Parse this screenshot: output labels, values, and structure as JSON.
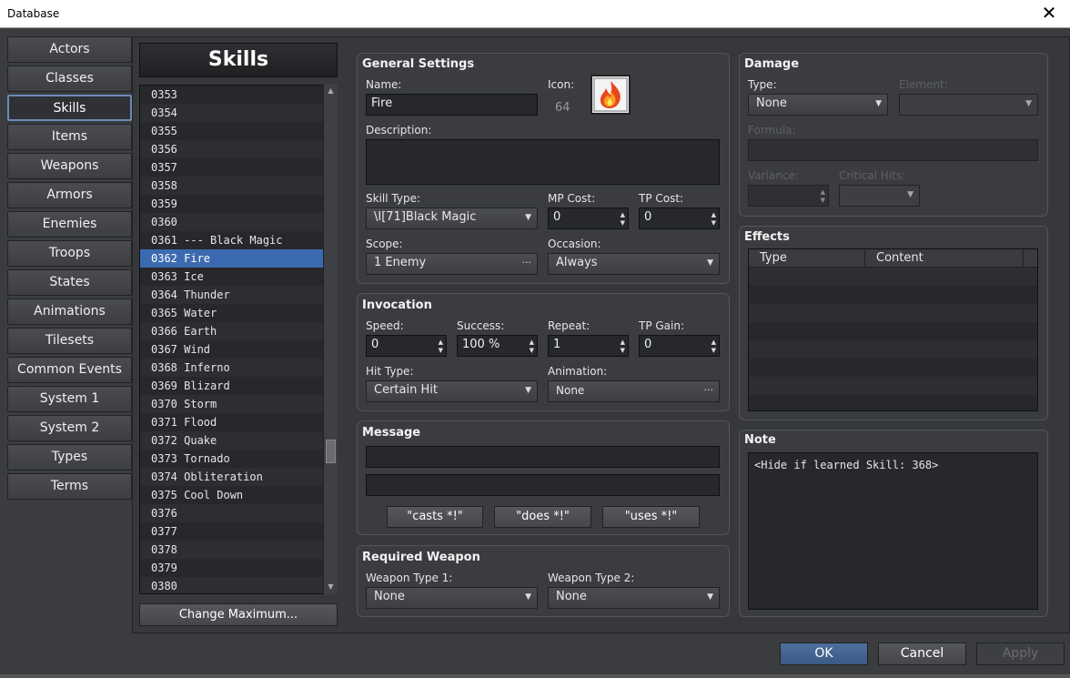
{
  "window": {
    "title": "Database",
    "close_glyph": "✕"
  },
  "nav": [
    "Actors",
    "Classes",
    "Skills",
    "Items",
    "Weapons",
    "Armors",
    "Enemies",
    "Troops",
    "States",
    "Animations",
    "Tilesets",
    "Common Events",
    "System 1",
    "System 2",
    "Types",
    "Terms"
  ],
  "nav_active_index": 2,
  "list": {
    "title": "Skills",
    "rows": [
      "0353",
      "0354",
      "0355",
      "0356",
      "0357",
      "0358",
      "0359",
      "0360",
      "0361 --- Black Magic",
      "0362 Fire",
      "0363 Ice",
      "0364 Thunder",
      "0365 Water",
      "0366 Earth",
      "0367 Wind",
      "0368 Inferno",
      "0369 Blizard",
      "0370 Storm",
      "0371 Flood",
      "0372 Quake",
      "0373 Tornado",
      "0374 Obliteration",
      "0375 Cool Down",
      "0376",
      "0377",
      "0378",
      "0379",
      "0380"
    ],
    "selected_index": 9,
    "change_max": "Change Maximum..."
  },
  "general": {
    "title": "General Settings",
    "name_label": "Name:",
    "name": "Fire",
    "icon_label": "Icon:",
    "icon_index": "64",
    "icon_name": "fire-skill-icon",
    "description_label": "Description:",
    "description": "",
    "skill_type_label": "Skill Type:",
    "skill_type": "\\I[71]Black Magic",
    "mp_cost_label": "MP Cost:",
    "mp_cost": "0",
    "tp_cost_label": "TP Cost:",
    "tp_cost": "0",
    "scope_label": "Scope:",
    "scope": "1 Enemy",
    "occasion_label": "Occasion:",
    "occasion": "Always"
  },
  "invocation": {
    "title": "Invocation",
    "speed_label": "Speed:",
    "speed": "0",
    "success_label": "Success:",
    "success": "100 %",
    "repeat_label": "Repeat:",
    "repeat": "1",
    "tp_gain_label": "TP Gain:",
    "tp_gain": "0",
    "hit_type_label": "Hit Type:",
    "hit_type": "Certain Hit",
    "animation_label": "Animation:",
    "animation": "None"
  },
  "message": {
    "title": "Message",
    "line1": "",
    "line2": "",
    "buttons": [
      "\"casts *!\"",
      "\"does *!\"",
      "\"uses *!\""
    ]
  },
  "required_weapon": {
    "title": "Required Weapon",
    "type1_label": "Weapon Type 1:",
    "type1": "None",
    "type2_label": "Weapon Type 2:",
    "type2": "None"
  },
  "damage": {
    "title": "Damage",
    "type_label": "Type:",
    "type": "None",
    "element_label": "Element:",
    "element": "",
    "formula_label": "Formula:",
    "formula": "",
    "variance_label": "Variance:",
    "variance": "",
    "critical_label": "Critical Hits:",
    "critical": ""
  },
  "effects": {
    "title": "Effects",
    "columns": [
      "Type",
      "Content"
    ]
  },
  "note": {
    "title": "Note",
    "text": "<Hide if learned Skill: 368>"
  },
  "dialog_buttons": {
    "ok": "OK",
    "cancel": "Cancel",
    "apply": "Apply"
  },
  "colors": {
    "accent": "#3c6ab0",
    "panel": "#3a3c40",
    "field": "#26282b"
  }
}
